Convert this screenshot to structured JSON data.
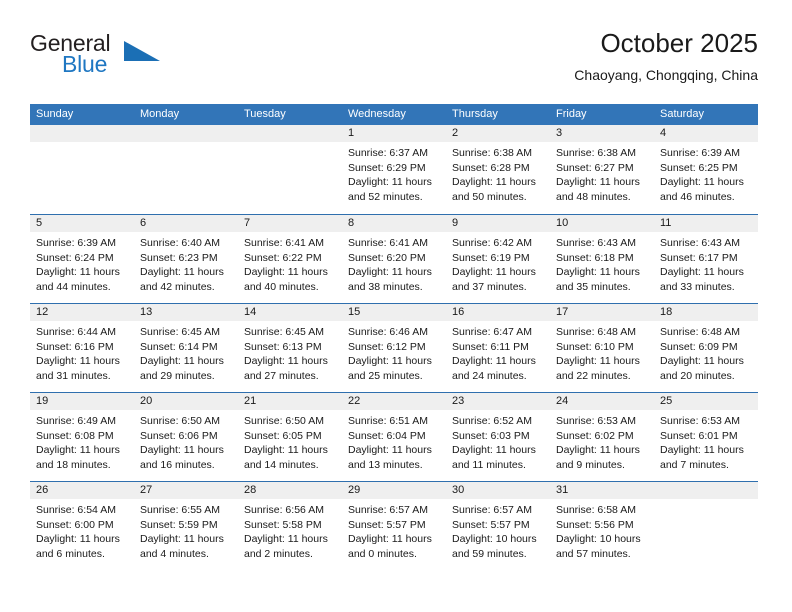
{
  "brand": {
    "word1": "General",
    "word2": "Blue",
    "accent_color": "#1b6fb5"
  },
  "header": {
    "title": "October 2025",
    "subtitle": "Chaoyang, Chongqing, China"
  },
  "calendar": {
    "header_bg": "#3275b8",
    "daynum_bg": "#efefef",
    "weekday_headers": [
      "Sunday",
      "Monday",
      "Tuesday",
      "Wednesday",
      "Thursday",
      "Friday",
      "Saturday"
    ],
    "weeks": [
      [
        {
          "day": "",
          "lines": []
        },
        {
          "day": "",
          "lines": []
        },
        {
          "day": "",
          "lines": []
        },
        {
          "day": "1",
          "lines": [
            "Sunrise: 6:37 AM",
            "Sunset: 6:29 PM",
            "Daylight: 11 hours",
            "and 52 minutes."
          ]
        },
        {
          "day": "2",
          "lines": [
            "Sunrise: 6:38 AM",
            "Sunset: 6:28 PM",
            "Daylight: 11 hours",
            "and 50 minutes."
          ]
        },
        {
          "day": "3",
          "lines": [
            "Sunrise: 6:38 AM",
            "Sunset: 6:27 PM",
            "Daylight: 11 hours",
            "and 48 minutes."
          ]
        },
        {
          "day": "4",
          "lines": [
            "Sunrise: 6:39 AM",
            "Sunset: 6:25 PM",
            "Daylight: 11 hours",
            "and 46 minutes."
          ]
        }
      ],
      [
        {
          "day": "5",
          "lines": [
            "Sunrise: 6:39 AM",
            "Sunset: 6:24 PM",
            "Daylight: 11 hours",
            "and 44 minutes."
          ]
        },
        {
          "day": "6",
          "lines": [
            "Sunrise: 6:40 AM",
            "Sunset: 6:23 PM",
            "Daylight: 11 hours",
            "and 42 minutes."
          ]
        },
        {
          "day": "7",
          "lines": [
            "Sunrise: 6:41 AM",
            "Sunset: 6:22 PM",
            "Daylight: 11 hours",
            "and 40 minutes."
          ]
        },
        {
          "day": "8",
          "lines": [
            "Sunrise: 6:41 AM",
            "Sunset: 6:20 PM",
            "Daylight: 11 hours",
            "and 38 minutes."
          ]
        },
        {
          "day": "9",
          "lines": [
            "Sunrise: 6:42 AM",
            "Sunset: 6:19 PM",
            "Daylight: 11 hours",
            "and 37 minutes."
          ]
        },
        {
          "day": "10",
          "lines": [
            "Sunrise: 6:43 AM",
            "Sunset: 6:18 PM",
            "Daylight: 11 hours",
            "and 35 minutes."
          ]
        },
        {
          "day": "11",
          "lines": [
            "Sunrise: 6:43 AM",
            "Sunset: 6:17 PM",
            "Daylight: 11 hours",
            "and 33 minutes."
          ]
        }
      ],
      [
        {
          "day": "12",
          "lines": [
            "Sunrise: 6:44 AM",
            "Sunset: 6:16 PM",
            "Daylight: 11 hours",
            "and 31 minutes."
          ]
        },
        {
          "day": "13",
          "lines": [
            "Sunrise: 6:45 AM",
            "Sunset: 6:14 PM",
            "Daylight: 11 hours",
            "and 29 minutes."
          ]
        },
        {
          "day": "14",
          "lines": [
            "Sunrise: 6:45 AM",
            "Sunset: 6:13 PM",
            "Daylight: 11 hours",
            "and 27 minutes."
          ]
        },
        {
          "day": "15",
          "lines": [
            "Sunrise: 6:46 AM",
            "Sunset: 6:12 PM",
            "Daylight: 11 hours",
            "and 25 minutes."
          ]
        },
        {
          "day": "16",
          "lines": [
            "Sunrise: 6:47 AM",
            "Sunset: 6:11 PM",
            "Daylight: 11 hours",
            "and 24 minutes."
          ]
        },
        {
          "day": "17",
          "lines": [
            "Sunrise: 6:48 AM",
            "Sunset: 6:10 PM",
            "Daylight: 11 hours",
            "and 22 minutes."
          ]
        },
        {
          "day": "18",
          "lines": [
            "Sunrise: 6:48 AM",
            "Sunset: 6:09 PM",
            "Daylight: 11 hours",
            "and 20 minutes."
          ]
        }
      ],
      [
        {
          "day": "19",
          "lines": [
            "Sunrise: 6:49 AM",
            "Sunset: 6:08 PM",
            "Daylight: 11 hours",
            "and 18 minutes."
          ]
        },
        {
          "day": "20",
          "lines": [
            "Sunrise: 6:50 AM",
            "Sunset: 6:06 PM",
            "Daylight: 11 hours",
            "and 16 minutes."
          ]
        },
        {
          "day": "21",
          "lines": [
            "Sunrise: 6:50 AM",
            "Sunset: 6:05 PM",
            "Daylight: 11 hours",
            "and 14 minutes."
          ]
        },
        {
          "day": "22",
          "lines": [
            "Sunrise: 6:51 AM",
            "Sunset: 6:04 PM",
            "Daylight: 11 hours",
            "and 13 minutes."
          ]
        },
        {
          "day": "23",
          "lines": [
            "Sunrise: 6:52 AM",
            "Sunset: 6:03 PM",
            "Daylight: 11 hours",
            "and 11 minutes."
          ]
        },
        {
          "day": "24",
          "lines": [
            "Sunrise: 6:53 AM",
            "Sunset: 6:02 PM",
            "Daylight: 11 hours",
            "and 9 minutes."
          ]
        },
        {
          "day": "25",
          "lines": [
            "Sunrise: 6:53 AM",
            "Sunset: 6:01 PM",
            "Daylight: 11 hours",
            "and 7 minutes."
          ]
        }
      ],
      [
        {
          "day": "26",
          "lines": [
            "Sunrise: 6:54 AM",
            "Sunset: 6:00 PM",
            "Daylight: 11 hours",
            "and 6 minutes."
          ]
        },
        {
          "day": "27",
          "lines": [
            "Sunrise: 6:55 AM",
            "Sunset: 5:59 PM",
            "Daylight: 11 hours",
            "and 4 minutes."
          ]
        },
        {
          "day": "28",
          "lines": [
            "Sunrise: 6:56 AM",
            "Sunset: 5:58 PM",
            "Daylight: 11 hours",
            "and 2 minutes."
          ]
        },
        {
          "day": "29",
          "lines": [
            "Sunrise: 6:57 AM",
            "Sunset: 5:57 PM",
            "Daylight: 11 hours",
            "and 0 minutes."
          ]
        },
        {
          "day": "30",
          "lines": [
            "Sunrise: 6:57 AM",
            "Sunset: 5:57 PM",
            "Daylight: 10 hours",
            "and 59 minutes."
          ]
        },
        {
          "day": "31",
          "lines": [
            "Sunrise: 6:58 AM",
            "Sunset: 5:56 PM",
            "Daylight: 10 hours",
            "and 57 minutes."
          ]
        },
        {
          "day": "",
          "lines": []
        }
      ]
    ]
  }
}
